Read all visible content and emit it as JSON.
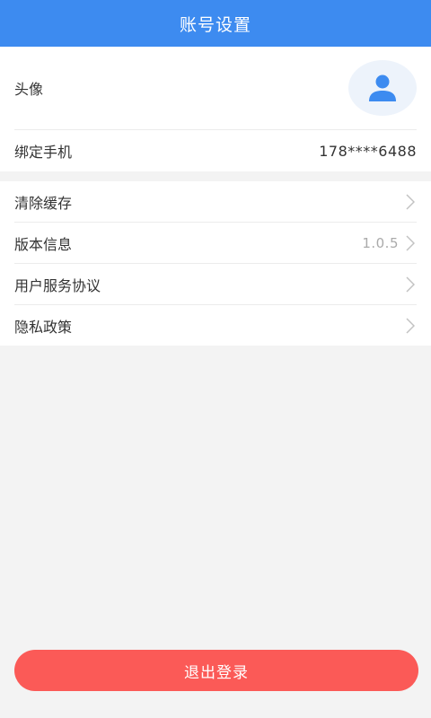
{
  "header": {
    "title": "账号设置"
  },
  "profile": {
    "avatar_label": "头像",
    "phone_label": "绑定手机",
    "phone_value": "178****6488"
  },
  "menu": {
    "clear_cache": "清除缓存",
    "version_label": "版本信息",
    "version_value": "1.0.5",
    "user_agreement": "用户服务协议",
    "privacy_policy": "隐私政策"
  },
  "logout": {
    "label": "退出登录"
  },
  "colors": {
    "accent": "#3d8bf0",
    "logout": "#fb5a57",
    "background": "#f3f3f3"
  },
  "icons": [
    "user-icon",
    "chevron-right-icon"
  ]
}
